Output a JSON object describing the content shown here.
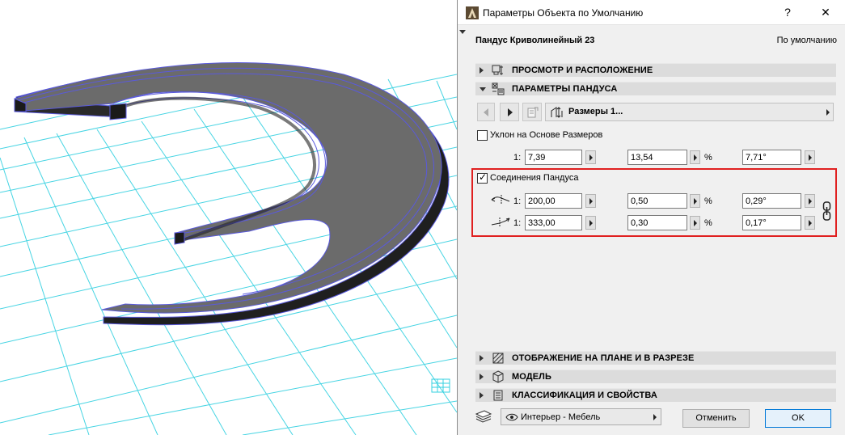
{
  "dialog": {
    "title": "Параметры Объекта по Умолчанию",
    "help_label": "?",
    "close_label": "✕",
    "object_name": "Пандус Криволинейный 23",
    "default_label": "По умолчанию"
  },
  "sections": {
    "preview": "ПРОСМОТР И РАСПОЛОЖЕНИЕ",
    "ramp_params": "ПАРАМЕТРЫ ПАНДУСА",
    "floor_plan": "ОТОБРАЖЕНИЕ НА ПЛАНЕ И В РАЗРЕЗЕ",
    "model": "МОДЕЛЬ",
    "classification": "КЛАССИФИКАЦИЯ И СВОЙСТВА"
  },
  "toolbar": {
    "page_dropdown": "Размеры 1..."
  },
  "slope": {
    "checkbox_label": "Уклон на Основе Размеров",
    "checked": false,
    "ratio_prefix": "1:",
    "ratio": "7,39",
    "percent": "13,54",
    "percent_unit": "%",
    "angle": "7,71°"
  },
  "connections": {
    "checkbox_label": "Соединения Пандуса",
    "checked": true,
    "rows": [
      {
        "ratio_prefix": "1:",
        "ratio": "200,00",
        "percent": "0,50",
        "percent_unit": "%",
        "angle": "0,29°"
      },
      {
        "ratio_prefix": "1:",
        "ratio": "333,00",
        "percent": "0,30",
        "percent_unit": "%",
        "angle": "0,17°"
      }
    ]
  },
  "footer": {
    "layer": "Интерьер - Мебель",
    "cancel": "Отменить",
    "ok": "OK"
  },
  "colors": {
    "highlight": "#e02020",
    "ramp_top": "#6b6b6b",
    "ramp_side": "#2a2a2a",
    "ramp_edge": "#5a5adc",
    "grid": "#33d0e0"
  },
  "icons": {
    "app": "archicad-icon",
    "help": "help-icon",
    "close": "close-icon",
    "preview": "preview-icon",
    "ramp_params": "ramp-params-icon",
    "floor_plan": "floor-plan-icon",
    "model": "model-cube-icon",
    "classification": "classification-icon",
    "chain": "chain-link-icon",
    "layer": "layer-icon",
    "eye": "eye-icon"
  }
}
